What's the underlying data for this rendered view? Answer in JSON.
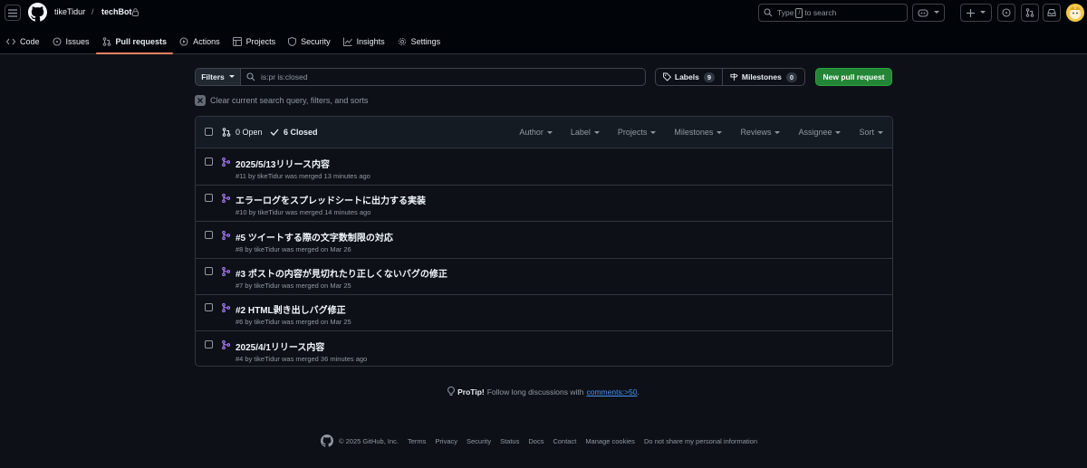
{
  "header": {
    "owner": "tikeTidur",
    "separator": "/",
    "repo": "techBot",
    "search_prefix": "Type",
    "search_key": "/",
    "search_suffix": "to search"
  },
  "tabs": [
    {
      "label": "Code"
    },
    {
      "label": "Issues"
    },
    {
      "label": "Pull requests"
    },
    {
      "label": "Actions"
    },
    {
      "label": "Projects"
    },
    {
      "label": "Security"
    },
    {
      "label": "Insights"
    },
    {
      "label": "Settings"
    }
  ],
  "filters": {
    "label": "Filters",
    "query": "is:pr is:closed",
    "labels_label": "Labels",
    "labels_count": "9",
    "milestones_label": "Milestones",
    "milestones_count": "0",
    "new_pr": "New pull request",
    "clear_text": "Clear current search query, filters, and sorts"
  },
  "list": {
    "open_label": "0 Open",
    "closed_label": "6 Closed",
    "sorts": [
      "Author",
      "Label",
      "Projects",
      "Milestones",
      "Reviews",
      "Assignee",
      "Sort"
    ],
    "items": [
      {
        "title": "2025/5/13リリース内容",
        "meta": "#11 by tikeTidur was merged 13 minutes ago"
      },
      {
        "title": "エラーログをスプレッドシートに出力する実装",
        "meta": "#10 by tikeTidur was merged 14 minutes ago"
      },
      {
        "title": "#5 ツイートする際の文字数制限の対応",
        "meta": "#8 by tikeTidur was merged on Mar 26"
      },
      {
        "title": "#3 ポストの内容が見切れたり正しくないバグの修正",
        "meta": "#7 by tikeTidur was merged on Mar 25"
      },
      {
        "title": "#2 HTML剥き出しバグ修正",
        "meta": "#6 by tikeTidur was merged on Mar 25"
      },
      {
        "title": "2025/4/1リリース内容",
        "meta": "#4 by tikeTidur was merged 36 minutes ago"
      }
    ]
  },
  "protip": {
    "label": "ProTip!",
    "text": "Follow long discussions with",
    "link": "comments:>50",
    "end": "."
  },
  "footer": {
    "copyright": "© 2025 GitHub, Inc.",
    "links": [
      "Terms",
      "Privacy",
      "Security",
      "Status",
      "Docs",
      "Contact",
      "Manage cookies",
      "Do not share my personal information"
    ]
  },
  "colors": {
    "merged": "#ab7df8",
    "accent_tab": "#f78166",
    "new_button": "#238636",
    "link": "#4493f8"
  }
}
